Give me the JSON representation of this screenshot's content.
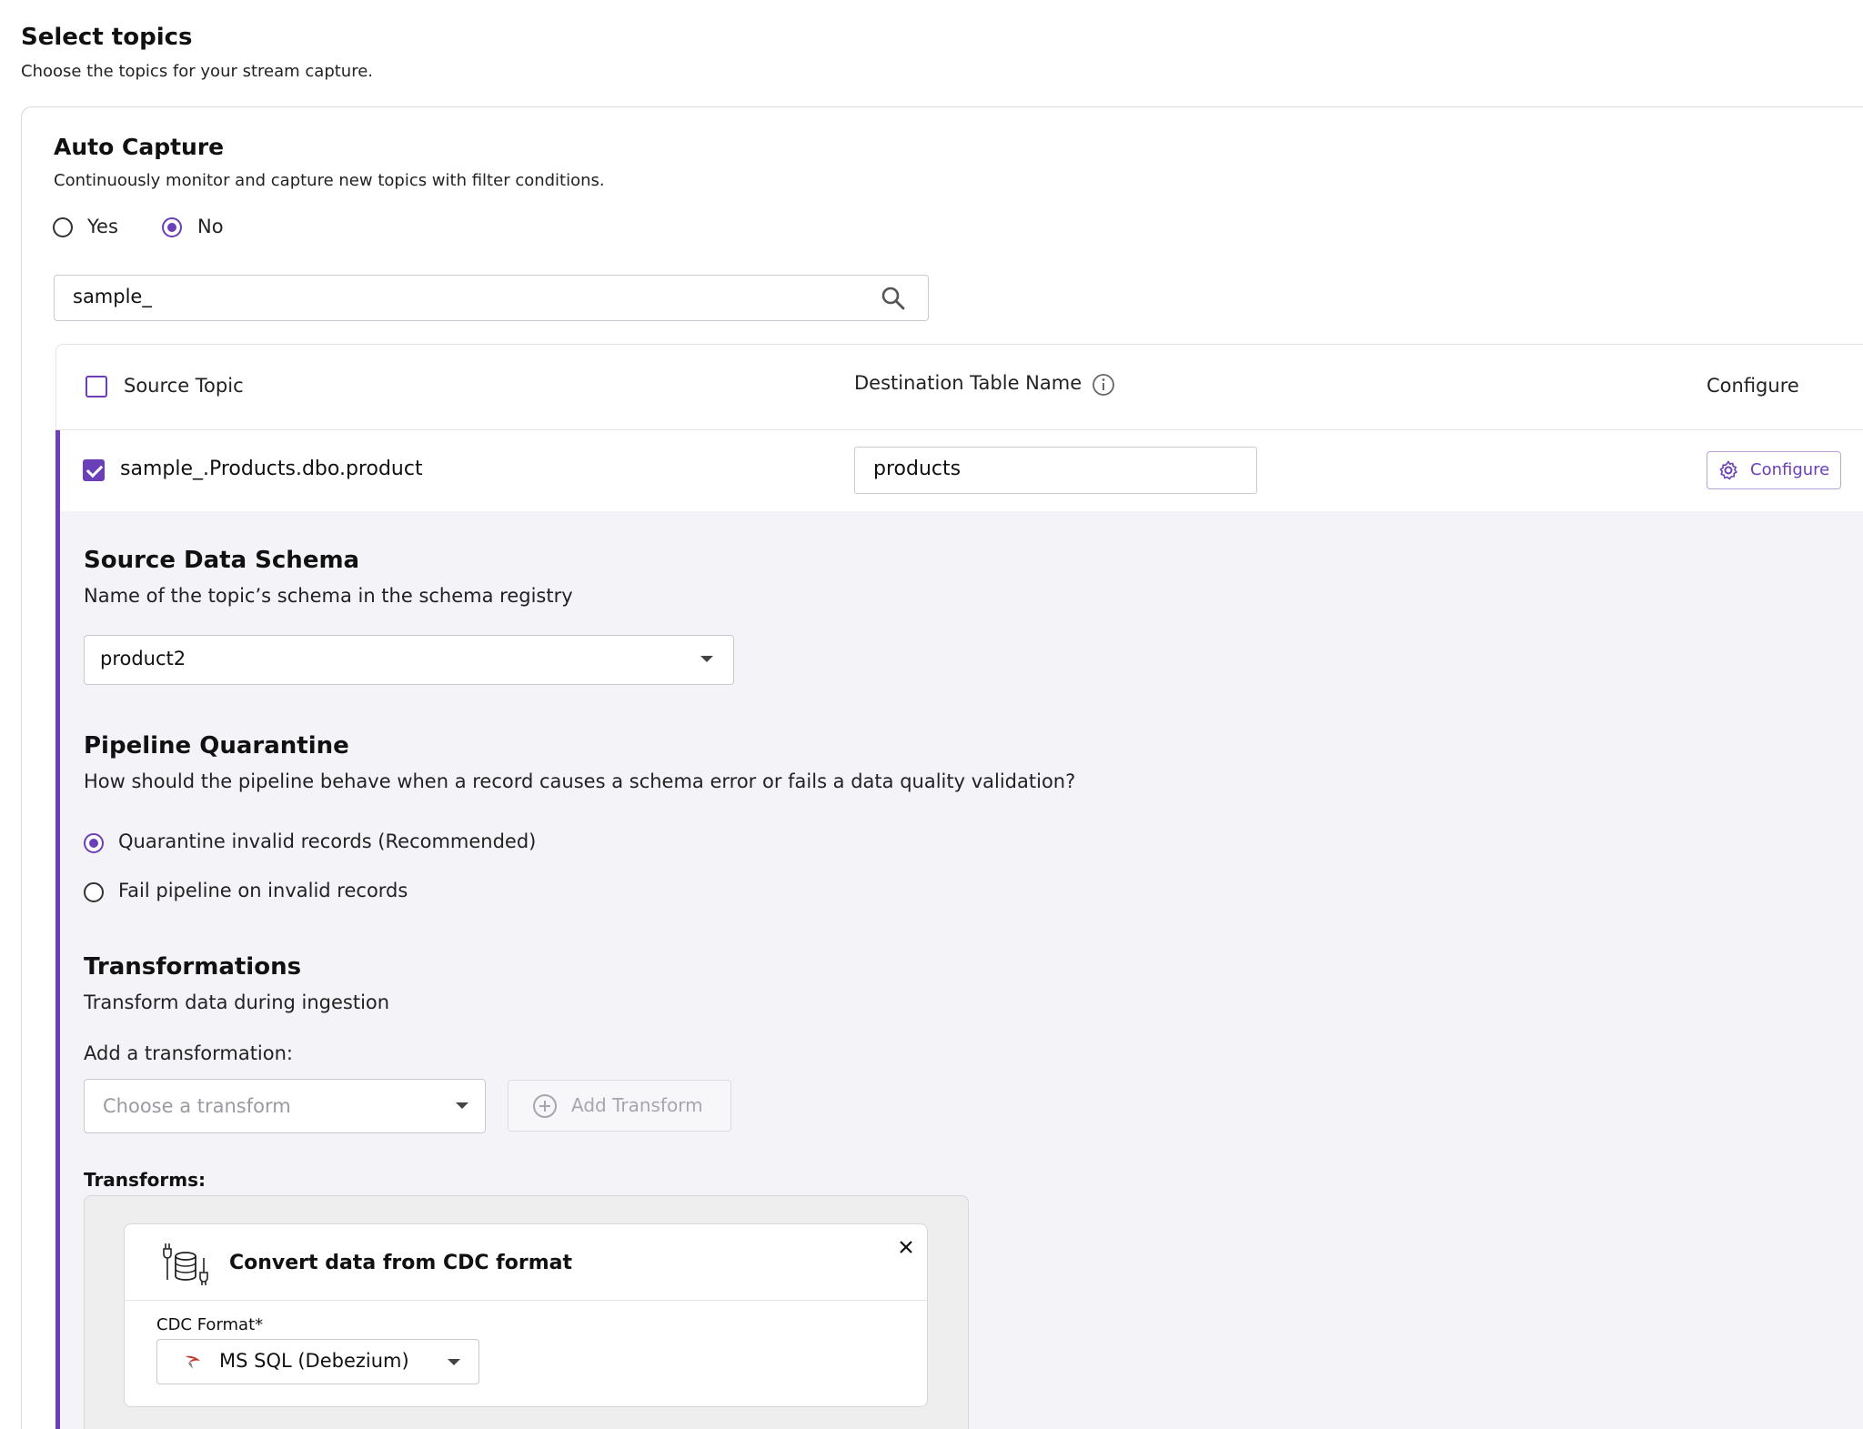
{
  "header": {
    "title": "Select topics",
    "subtitle": "Choose the topics for your stream capture."
  },
  "auto_capture": {
    "title": "Auto Capture",
    "subtitle": "Continuously monitor and capture new topics with filter conditions.",
    "options": [
      {
        "label": "Yes",
        "selected": false
      },
      {
        "label": "No",
        "selected": true
      }
    ]
  },
  "search": {
    "value": "sample_",
    "icon": "search-icon"
  },
  "table": {
    "columns": {
      "source": "Source Topic",
      "destination": "Destination Table Name",
      "configure": "Configure"
    },
    "rows": [
      {
        "checked": true,
        "source_topic": "sample_.Products.dbo.product",
        "destination_table": "products",
        "configure_label": "Configure"
      }
    ]
  },
  "expanded": {
    "schema": {
      "title": "Source Data Schema",
      "subtitle": "Name of the topic’s schema in the schema registry",
      "selected": "product2"
    },
    "quarantine": {
      "title": "Pipeline Quarantine",
      "subtitle": "How should the pipeline behave when a record causes a schema error or fails a data quality validation?",
      "options": [
        {
          "label": "Quarantine invalid records (Recommended)",
          "selected": true
        },
        {
          "label": "Fail pipeline on invalid records",
          "selected": false
        }
      ]
    },
    "transformations": {
      "title": "Transformations",
      "subtitle": "Transform data during ingestion",
      "add_label": "Add a transformation:",
      "select_placeholder": "Choose a transform",
      "add_button": "Add Transform",
      "list_label": "Transforms:",
      "items": [
        {
          "title": "Convert data from CDC format",
          "field_label": "CDC Format*",
          "field_value": "MS SQL (Debezium)"
        }
      ]
    }
  },
  "colors": {
    "accent": "#6b3fb8",
    "panel_bg": "#f4f4f8"
  }
}
